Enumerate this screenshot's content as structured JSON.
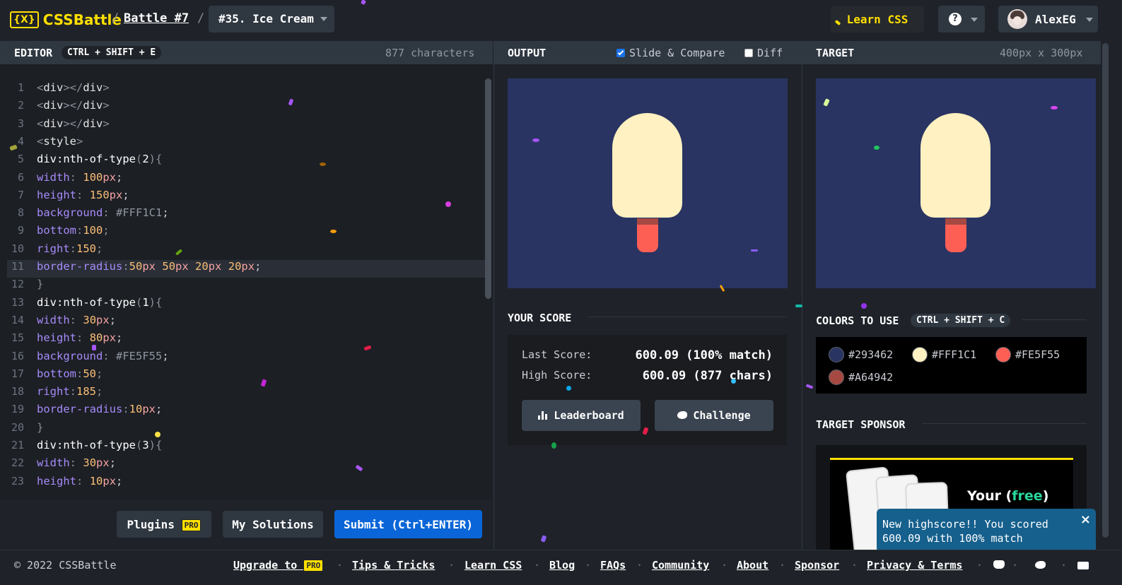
{
  "header": {
    "logo_text": "CSSBattle",
    "logo_mark": "{X}",
    "breadcrumb_battle": "Battle #7",
    "breadcrumb_sep": "/",
    "battle_select": "#35. Ice Cream",
    "learn_css": "Learn CSS",
    "help_icon": "?",
    "user_name": "AlexEG"
  },
  "editor": {
    "title": "EDITOR",
    "shortcut": "CTRL + SHIFT + E",
    "char_count": "877 characters",
    "lines": [
      "<div></div>",
      "<div></div>",
      "<div></div>",
      "<style>",
      "div:nth-of-type(2){",
      "width: 100px;",
      "height: 150px;",
      "background: #FFF1C1;",
      "bottom:100;",
      "right:150;",
      "border-radius:50px 50px 20px 20px;",
      "}",
      "div:nth-of-type(1){",
      "width: 30px;",
      "height: 80px;",
      "background: #FE5F55;",
      "bottom:50;",
      "right:185;",
      "border-radius:10px;",
      "}",
      "div:nth-of-type(3){",
      "width: 30px;",
      "height: 10px;"
    ],
    "line_numbers": [
      "1",
      "2",
      "3",
      "4",
      "5",
      "6",
      "7",
      "8",
      "9",
      "10",
      "11",
      "12",
      "13",
      "14",
      "15",
      "16",
      "17",
      "18",
      "19",
      "20",
      "21",
      "22",
      "23"
    ],
    "plugins_label": "Plugins",
    "pro_badge": "PRO",
    "solutions_label": "My Solutions",
    "submit_label": "Submit (Ctrl+ENTER)"
  },
  "output": {
    "title": "OUTPUT",
    "slide_compare": "Slide & Compare",
    "slide_compare_checked": true,
    "diff": "Diff",
    "diff_checked": false,
    "your_score_title": "YOUR SCORE",
    "last_score_label": "Last Score:",
    "last_score_value": "600.09 (100% match)",
    "high_score_label": "High Score:",
    "high_score_value": "600.09 (877 chars)",
    "leaderboard_label": "Leaderboard",
    "challenge_label": "Challenge"
  },
  "target": {
    "title": "TARGET",
    "size": "400px x 300px",
    "colors_title": "COLORS TO USE",
    "colors_shortcut": "CTRL + SHIFT + C",
    "colors": [
      {
        "hex": "#293462"
      },
      {
        "hex": "#FFF1C1"
      },
      {
        "hex": "#FE5F55"
      },
      {
        "hex": "#A64942"
      }
    ],
    "sponsor_title": "TARGET SPONSOR",
    "sponsor_text_1": "Your (",
    "sponsor_text_free": "free",
    "sponsor_text_2": ")"
  },
  "toast": {
    "message": "New highscore!! You scored 600.09 with 100% match",
    "close": "×"
  },
  "footer": {
    "copyright": "© 2022 CSSBattle",
    "upgrade_label": "Upgrade to",
    "links": [
      "Tips & Tricks",
      "Learn CSS",
      "Blog",
      "FAQs",
      "Community",
      "About",
      "Sponsor",
      "Privacy & Terms"
    ],
    "separator": "·"
  },
  "colors": {
    "accent_yellow": "#FFDF00",
    "submit_blue": "#0A66D8",
    "canvas_bg": "#293462",
    "toast_bg": "#16608D"
  }
}
